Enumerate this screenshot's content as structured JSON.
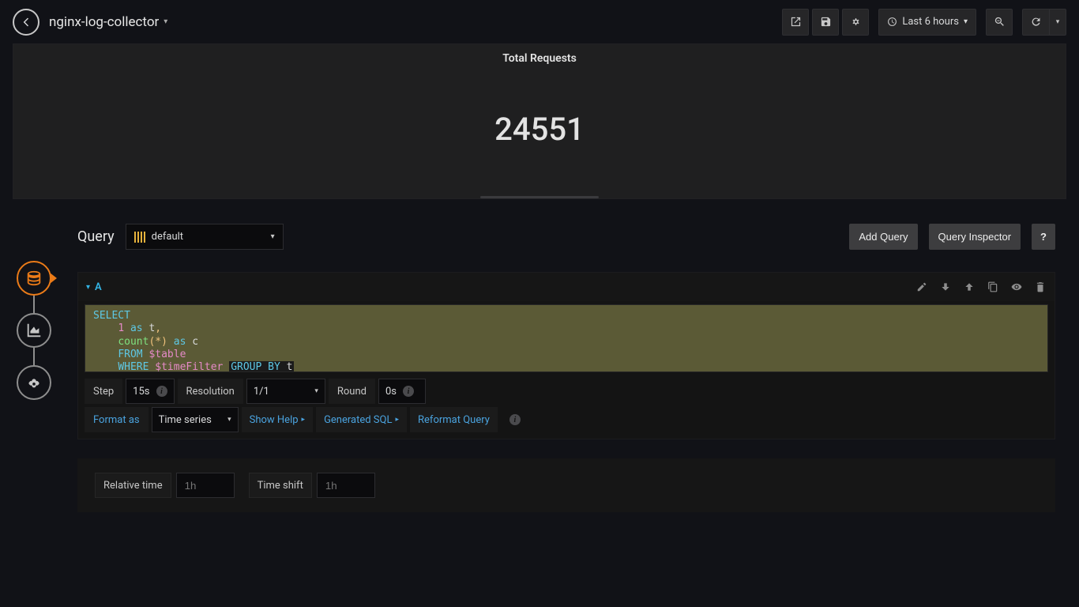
{
  "topbar": {
    "title": "nginx-log-collector",
    "time_range": "Last 6 hours"
  },
  "panel": {
    "title": "Total Requests",
    "value": "24551"
  },
  "query_head": {
    "label": "Query",
    "datasource": "default",
    "add_query": "Add Query",
    "inspector": "Query Inspector",
    "help": "?"
  },
  "query_row": {
    "letter": "A"
  },
  "sql": {
    "select": "SELECT",
    "one": "1",
    "as1": " as ",
    "t1": "t",
    "comma": ",",
    "count": "count",
    "lpar": "(",
    "star": "*",
    "rpar": ")",
    "as2": " as ",
    "c": "c",
    "from": "FROM",
    "table": " $table",
    "where": "WHERE",
    "tf": " $timeFilter ",
    "groupby": "GROUP BY",
    "t2": " t"
  },
  "opts": {
    "step_label": "Step",
    "step_value": "15s",
    "res_label": "Resolution",
    "res_value": "1/1",
    "round_label": "Round",
    "round_value": "0s",
    "format_label": "Format as",
    "format_value": "Time series",
    "show_help": "Show Help",
    "gen_sql": "Generated SQL",
    "reformat": "Reformat Query"
  },
  "time_section": {
    "rel_label": "Relative time",
    "rel_ph": "1h",
    "shift_label": "Time shift",
    "shift_ph": "1h"
  }
}
